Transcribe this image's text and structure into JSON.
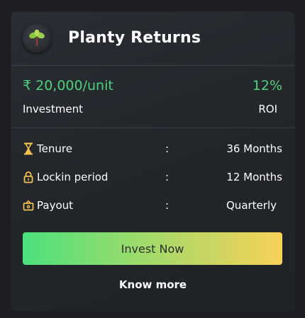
{
  "card": {
    "title": "Planty Returns",
    "logo_icon": "sapling-icon",
    "investment": {
      "price": "₹ 20,000/unit",
      "price_label": "Investment",
      "roi": "12%",
      "roi_label": "ROI"
    },
    "details": [
      {
        "icon": "hourglass-icon",
        "label": "Tenure",
        "separator": ":",
        "value": "36 Months"
      },
      {
        "icon": "lock-icon",
        "label": "Lockin period",
        "separator": ":",
        "value": "12 Months"
      },
      {
        "icon": "wallet-icon",
        "label": "Payout",
        "separator": ":",
        "value": "Quarterly"
      }
    ],
    "cta_label": "Invest Now",
    "link_label": "Know more"
  },
  "colors": {
    "accent_green": "#4cd27a",
    "icon_yellow": "#f2c14e",
    "gradient_start": "#4be17d",
    "gradient_end": "#f8d158"
  }
}
